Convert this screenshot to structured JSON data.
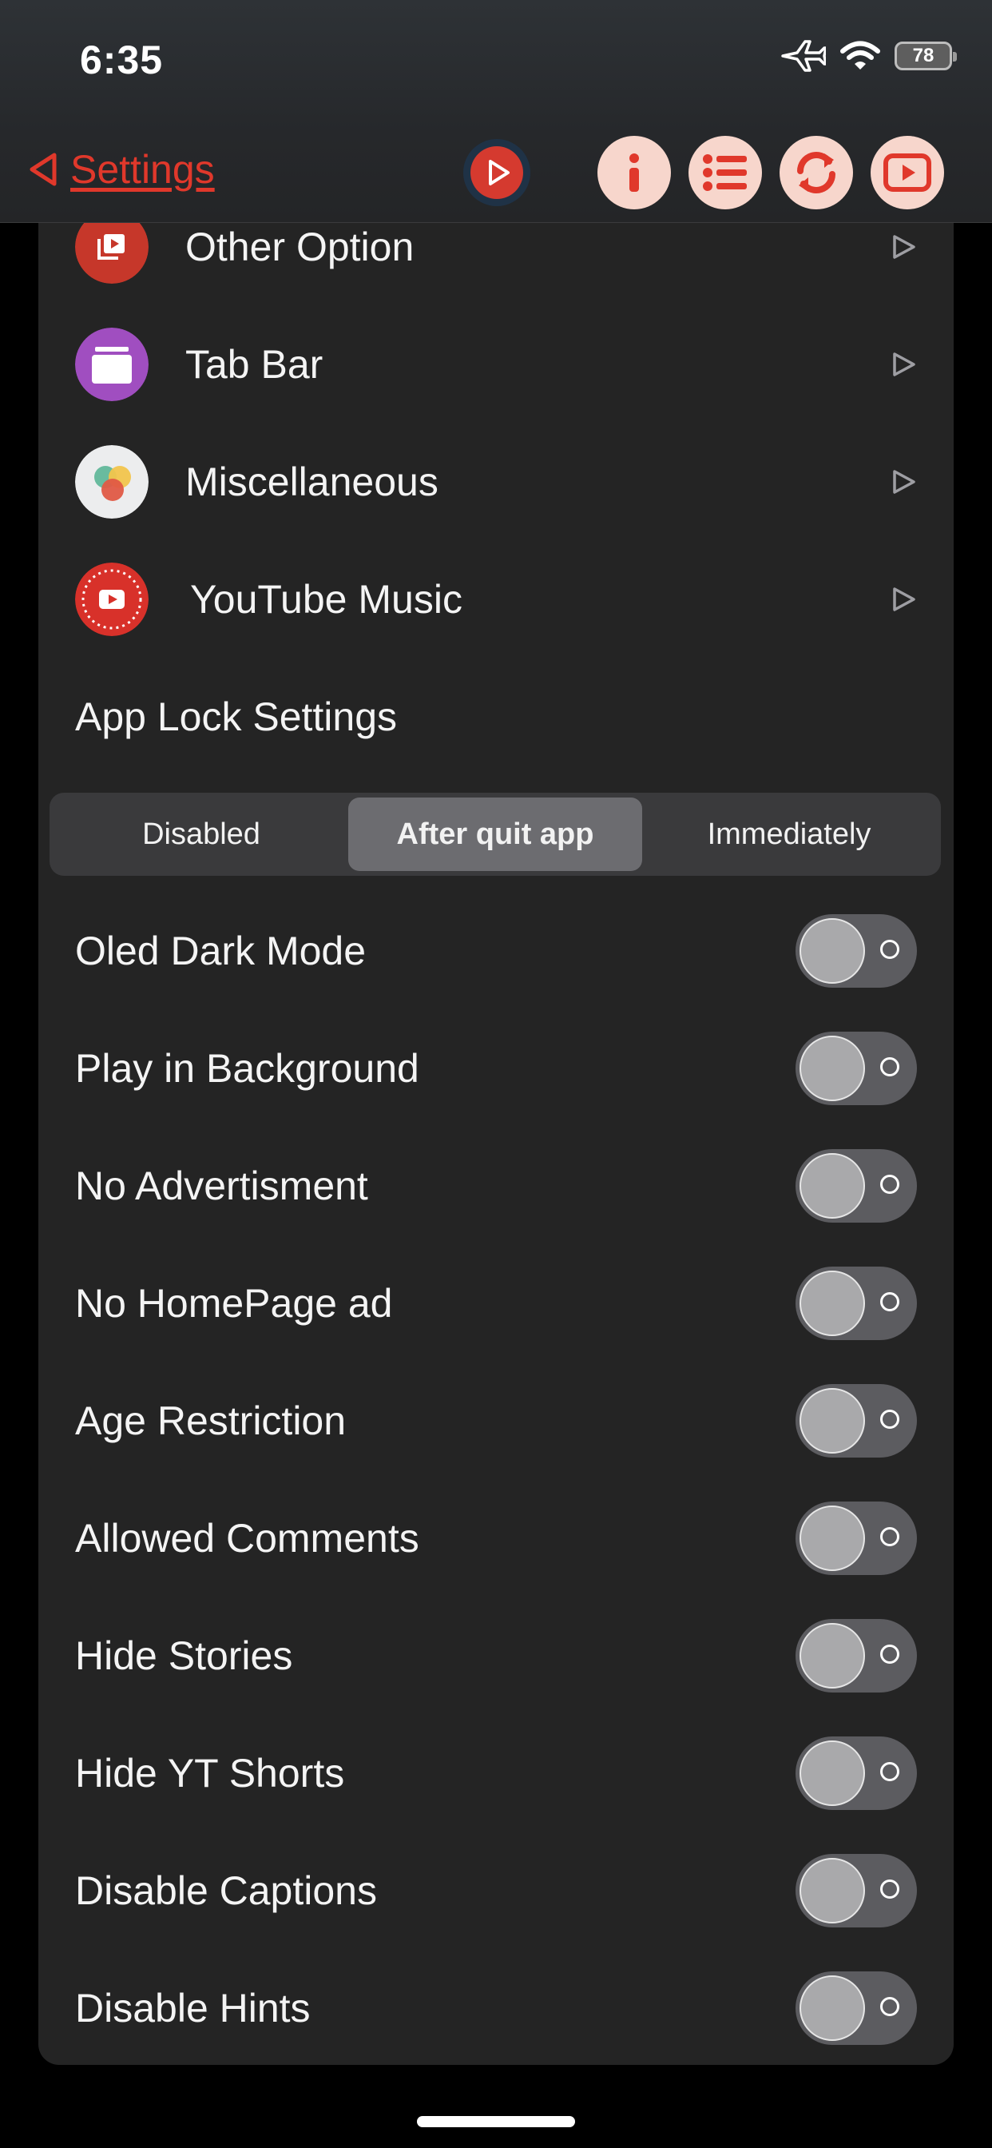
{
  "status": {
    "time": "6:35",
    "battery": "78"
  },
  "nav": {
    "back_label": "Settings"
  },
  "colors": {
    "accent": "#e0382b",
    "card_bg": "#242424",
    "button_bg": "#f7d6cc"
  },
  "icons": [
    "airplane-icon",
    "wifi-icon",
    "battery-icon",
    "back-triangle-icon",
    "play-circle-icon",
    "info-icon",
    "list-icon",
    "refresh-icon",
    "youtube-icon",
    "chevron-right-icon"
  ],
  "menu_items": [
    {
      "label": "Other Option",
      "icon": "other-option-icon"
    },
    {
      "label": "Tab Bar",
      "icon": "tab-bar-icon"
    },
    {
      "label": "Miscellaneous",
      "icon": "miscellaneous-icon"
    },
    {
      "label": "YouTube Music",
      "icon": "youtube-music-icon"
    }
  ],
  "app_lock": {
    "title": "App Lock Settings",
    "options": [
      "Disabled",
      "After quit app",
      "Immediately"
    ],
    "selected": "After quit app"
  },
  "toggles": [
    {
      "label": "Oled Dark Mode",
      "on": false
    },
    {
      "label": "Play in Background",
      "on": false
    },
    {
      "label": "No Advertisment",
      "on": false
    },
    {
      "label": "No HomePage ad",
      "on": false
    },
    {
      "label": "Age Restriction",
      "on": false
    },
    {
      "label": "Allowed Comments",
      "on": false
    },
    {
      "label": "Hide Stories",
      "on": false
    },
    {
      "label": "Hide YT Shorts",
      "on": false
    },
    {
      "label": "Disable Captions",
      "on": false
    },
    {
      "label": "Disable Hints",
      "on": false
    }
  ]
}
